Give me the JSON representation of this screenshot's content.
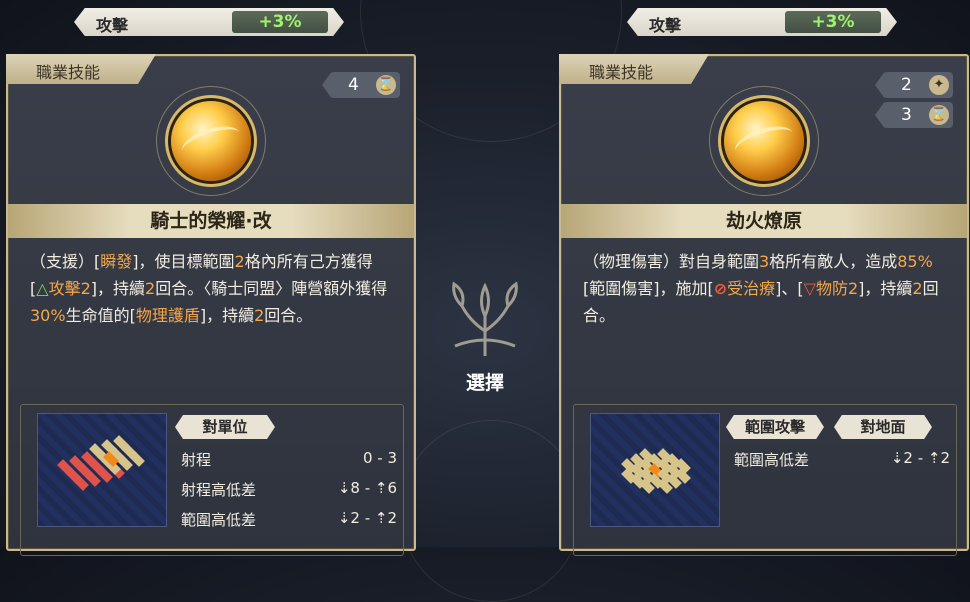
{
  "left": {
    "buff": {
      "stat": "攻擊",
      "value": "+3%"
    },
    "category": "職業技能",
    "costs": [
      {
        "value": "4",
        "icon": "hourglass-icon",
        "glyph": "⌛"
      }
    ],
    "name": "騎士的榮耀·改",
    "description": [
      {
        "t": "（支援）[",
        "c": ""
      },
      {
        "t": "瞬發",
        "c": "hl"
      },
      {
        "t": "]，使目標範圍",
        "c": ""
      },
      {
        "t": "2",
        "c": "hl"
      },
      {
        "t": "格內所有己方獲得[",
        "c": ""
      },
      {
        "t": "△",
        "c": "up"
      },
      {
        "t": "攻擊2",
        "c": "hl"
      },
      {
        "t": "]，持續",
        "c": ""
      },
      {
        "t": "2",
        "c": "hl"
      },
      {
        "t": "回合。〈騎士同盟〉陣營額外獲得",
        "c": ""
      },
      {
        "t": "30%",
        "c": "hl"
      },
      {
        "t": "生命值的[",
        "c": ""
      },
      {
        "t": "物理護盾",
        "c": "hl"
      },
      {
        "t": "]，持續",
        "c": ""
      },
      {
        "t": "2",
        "c": "hl"
      },
      {
        "t": "回合。",
        "c": ""
      }
    ],
    "tags": [
      "對單位"
    ],
    "stats": [
      {
        "label": "射程",
        "value": "0 - 3"
      },
      {
        "label": "射程高低差",
        "value": "⇣8 - ⇡6"
      },
      {
        "label": "範圍高低差",
        "value": "⇣2 - ⇡2"
      }
    ]
  },
  "right": {
    "buff": {
      "stat": "攻擊",
      "value": "+3%"
    },
    "category": "職業技能",
    "costs": [
      {
        "value": "2",
        "icon": "star-icon",
        "glyph": "✦"
      },
      {
        "value": "3",
        "icon": "hourglass-icon",
        "glyph": "⌛"
      }
    ],
    "name": "劫火燎原",
    "description": [
      {
        "t": "（物理傷害）對自身範圍",
        "c": ""
      },
      {
        "t": "3",
        "c": "hl"
      },
      {
        "t": "格所有敵人，造成",
        "c": ""
      },
      {
        "t": "85%",
        "c": "hl"
      },
      {
        "t": "[範圍傷害]，施加[",
        "c": ""
      },
      {
        "t": "⊘",
        "c": "no"
      },
      {
        "t": "受治療",
        "c": "hl"
      },
      {
        "t": "]、[",
        "c": ""
      },
      {
        "t": "▽",
        "c": "no"
      },
      {
        "t": "物防2",
        "c": "hl"
      },
      {
        "t": "]，持續",
        "c": ""
      },
      {
        "t": "2",
        "c": "hl"
      },
      {
        "t": "回合。",
        "c": ""
      }
    ],
    "tags": [
      "範圍攻擊",
      "對地面"
    ],
    "stats": [
      {
        "label": "範圍高低差",
        "value": "⇣2 - ⇡2"
      }
    ]
  },
  "center": {
    "select_label": "選擇"
  },
  "colors": {
    "gold": "#c9b98e",
    "buff_green": "#9ff36e",
    "highlight": "#f5a74a",
    "tile_red": "#e0524a",
    "tile_yellow": "#d6c489",
    "tile_center": "#f28a1a"
  }
}
